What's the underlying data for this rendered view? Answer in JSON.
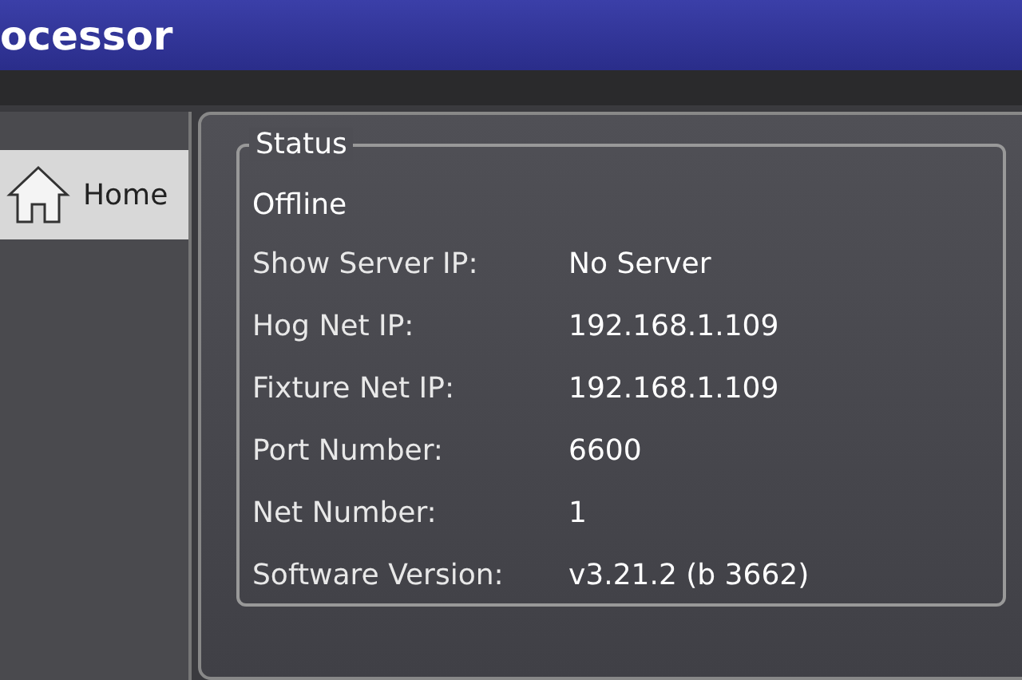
{
  "window": {
    "title": "ocessor"
  },
  "sidebar": {
    "items": [
      {
        "label": "Home",
        "selected": true
      }
    ]
  },
  "status": {
    "title": "Status",
    "state": "Offline",
    "rows": [
      {
        "label": "Show Server IP:",
        "value": "No Server"
      },
      {
        "label": "Hog Net IP:",
        "value": "192.168.1.109"
      },
      {
        "label": "Fixture Net IP:",
        "value": "192.168.1.109"
      },
      {
        "label": "Port Number:",
        "value": "6600"
      },
      {
        "label": "Net Number:",
        "value": "1"
      },
      {
        "label": "Software Version:",
        "value": "v3.21.2 (b 3662)"
      }
    ]
  }
}
